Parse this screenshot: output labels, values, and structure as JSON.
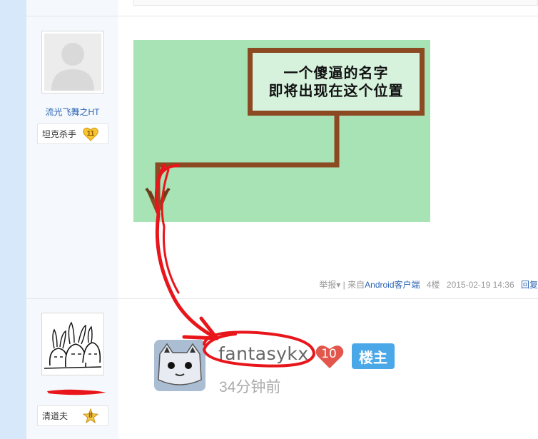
{
  "post1": {
    "username": "流光飞舞之HT",
    "rank_title": "坦克杀手",
    "rank_level": "11",
    "image": {
      "sign_line1": "一个傻逼的名字",
      "sign_line2": "即将出现在这个位置"
    },
    "meta": {
      "report": "举报",
      "report_arrow": "▾",
      "separator": "|",
      "from_prefix": "来自",
      "client": "Android客户端",
      "floor": "4楼",
      "datetime": "2015-02-19 14:36",
      "reply": "回复"
    }
  },
  "post2": {
    "rank_title": "清道夫",
    "rank_level": "8",
    "embedded_app_screenshot": {
      "name": "fantasykx",
      "level": "10",
      "host_badge": "楼主",
      "time": "34分钟前"
    }
  },
  "colors": {
    "link_blue": "#2d64b3",
    "user_column_bg": "#f5f9fd",
    "left_strip_bg": "#d6e8f9",
    "annotation_red": "#e8151b",
    "host_badge_blue": "#4aa8e8",
    "level_badge_red": "#e2564c"
  }
}
